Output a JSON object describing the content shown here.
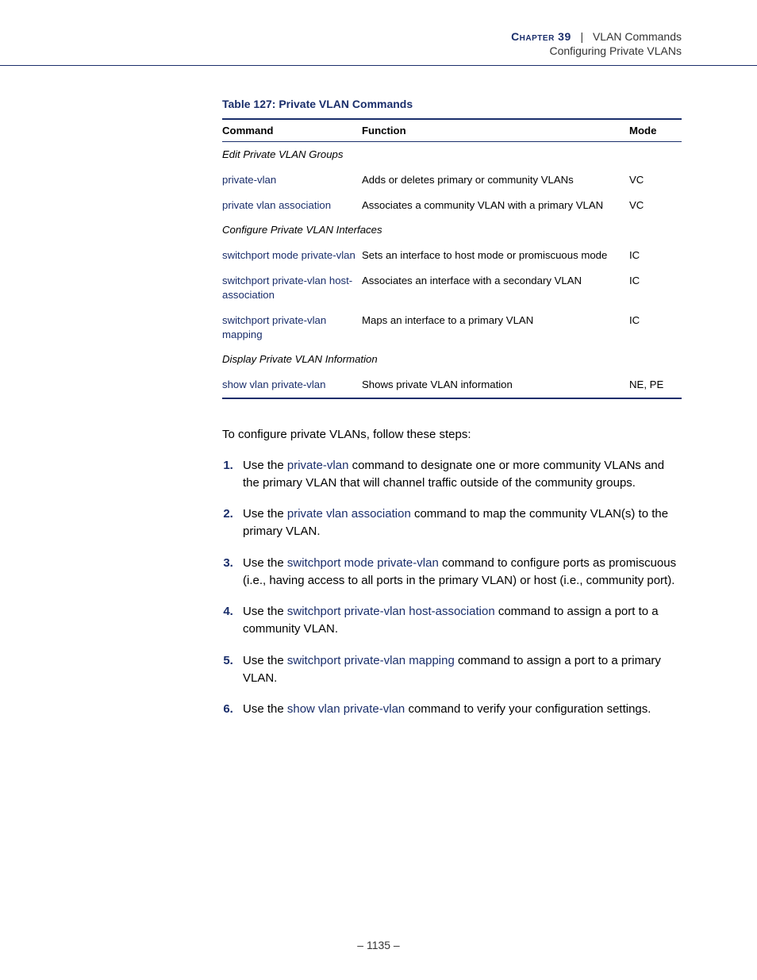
{
  "header": {
    "chapter_label": "Chapter 39",
    "chapter_title": "VLAN Commands",
    "subtitle": "Configuring Private VLANs"
  },
  "table": {
    "title": "Table 127: Private VLAN Commands",
    "head": {
      "command": "Command",
      "function": "Function",
      "mode": "Mode"
    },
    "section1": "Edit Private VLAN Groups",
    "rows1": [
      {
        "cmd": "private-vlan",
        "func": "Adds or deletes primary or community VLANs",
        "mode": "VC"
      },
      {
        "cmd": "private vlan association",
        "func": "Associates a community VLAN with a primary VLAN",
        "mode": "VC"
      }
    ],
    "section2": "Configure Private VLAN Interfaces",
    "rows2": [
      {
        "cmd": "switchport mode private-vlan",
        "func": "Sets an interface to host mode or promiscuous mode",
        "mode": "IC"
      },
      {
        "cmd": "switchport private-vlan host-association",
        "func": "Associates an interface with a secondary VLAN",
        "mode": "IC"
      },
      {
        "cmd": "switchport private-vlan mapping",
        "func": "Maps an interface to a primary VLAN",
        "mode": "IC"
      }
    ],
    "section3": "Display Private VLAN Information",
    "rows3": [
      {
        "cmd": "show vlan private-vlan",
        "func": "Shows private VLAN information",
        "mode": "NE, PE"
      }
    ]
  },
  "intro": "To configure private VLANs, follow these steps:",
  "steps": [
    {
      "pre": "Use the ",
      "link": "private-vlan",
      "post": " command to designate one or more community VLANs and the primary VLAN that will channel traffic outside of the community groups."
    },
    {
      "pre": "Use the ",
      "link": "private vlan association",
      "post": " command to map the community VLAN(s) to the primary VLAN."
    },
    {
      "pre": "Use the ",
      "link": "switchport mode private-vlan",
      "post": " command to configure ports as promiscuous (i.e., having access to all ports in the primary VLAN) or host (i.e., community port)."
    },
    {
      "pre": "Use the ",
      "link": "switchport private-vlan host-association",
      "post": " command to assign a port to a community VLAN."
    },
    {
      "pre": "Use the ",
      "link": "switchport private-vlan mapping",
      "post": " command to assign a port to a primary VLAN."
    },
    {
      "pre": "Use the ",
      "link": "show vlan private-vlan",
      "post": " command to verify your configuration settings."
    }
  ],
  "page_number": "–  1135  –",
  "chart_data": {
    "type": "table",
    "title": "Table 127: Private VLAN Commands",
    "columns": [
      "Command",
      "Function",
      "Mode"
    ],
    "sections": [
      {
        "heading": "Edit Private VLAN Groups",
        "rows": [
          [
            "private-vlan",
            "Adds or deletes primary or community VLANs",
            "VC"
          ],
          [
            "private vlan association",
            "Associates a community VLAN with a primary VLAN",
            "VC"
          ]
        ]
      },
      {
        "heading": "Configure Private VLAN Interfaces",
        "rows": [
          [
            "switchport mode private-vlan",
            "Sets an interface to host mode or promiscuous mode",
            "IC"
          ],
          [
            "switchport private-vlan host-association",
            "Associates an interface with a secondary VLAN",
            "IC"
          ],
          [
            "switchport private-vlan mapping",
            "Maps an interface to a primary VLAN",
            "IC"
          ]
        ]
      },
      {
        "heading": "Display Private VLAN Information",
        "rows": [
          [
            "show vlan private-vlan",
            "Shows private VLAN information",
            "NE, PE"
          ]
        ]
      }
    ]
  }
}
